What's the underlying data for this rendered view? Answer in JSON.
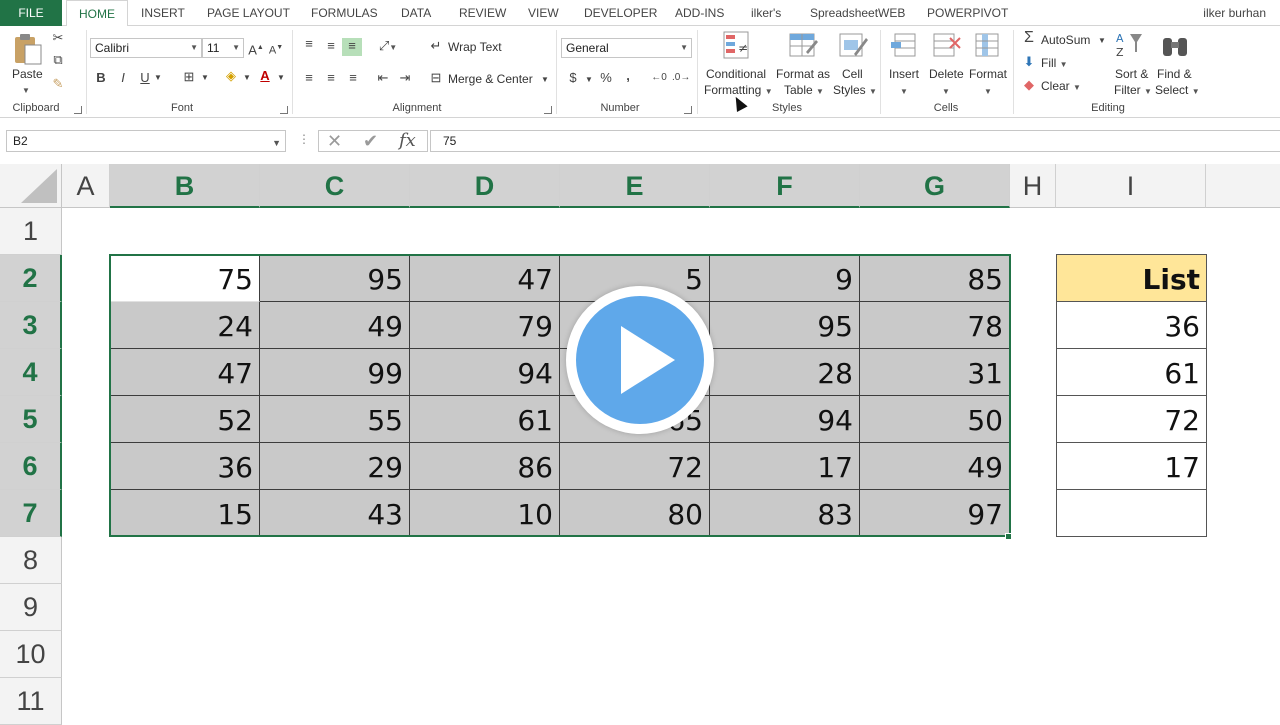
{
  "tabs": {
    "file": "FILE",
    "items": [
      "HOME",
      "INSERT",
      "PAGE LAYOUT",
      "FORMULAS",
      "DATA",
      "REVIEW",
      "VIEW",
      "DEVELOPER",
      "ADD-INS",
      "ilker's",
      "SpreadsheetWEB",
      "POWERPIVOT"
    ],
    "active": "HOME",
    "user": "ilker burhan"
  },
  "ribbon": {
    "clipboard": {
      "paste": "Paste",
      "label": "Clipboard"
    },
    "font": {
      "name": "Calibri",
      "size": "11",
      "label": "Font",
      "bold": "B",
      "italic": "I",
      "underline": "U"
    },
    "alignment": {
      "wrap": "Wrap Text",
      "merge": "Merge & Center",
      "label": "Alignment"
    },
    "number": {
      "format": "General",
      "label": "Number",
      "currency": "$",
      "percent": "%",
      "comma": ","
    },
    "styles": {
      "conditional_1": "Conditional",
      "conditional_2": "Formatting",
      "format_table_1": "Format as",
      "format_table_2": "Table",
      "cell_styles_1": "Cell",
      "cell_styles_2": "Styles",
      "label": "Styles"
    },
    "cells": {
      "insert": "Insert",
      "delete": "Delete",
      "format": "Format",
      "label": "Cells"
    },
    "editing": {
      "autosum": "AutoSum",
      "fill": "Fill",
      "clear": "Clear",
      "sort_1": "Sort &",
      "sort_2": "Filter",
      "find_1": "Find &",
      "find_2": "Select",
      "label": "Editing"
    }
  },
  "formula_bar": {
    "name_box": "B2",
    "formula": "75",
    "cancel_symbol": "✕",
    "enter_symbol": "✔",
    "fx_symbol": "fx"
  },
  "columns": [
    "A",
    "B",
    "C",
    "D",
    "E",
    "F",
    "G",
    "H",
    "I"
  ],
  "rows": [
    "1",
    "2",
    "3",
    "4",
    "5",
    "6",
    "7",
    "8",
    "9",
    "10",
    "11"
  ],
  "table": [
    [
      "75",
      "95",
      "47",
      "5",
      "9",
      "85"
    ],
    [
      "24",
      "49",
      "79",
      "",
      "95",
      "78"
    ],
    [
      "47",
      "99",
      "94",
      "",
      "28",
      "31"
    ],
    [
      "52",
      "55",
      "61",
      "65",
      "94",
      "50"
    ],
    [
      "36",
      "29",
      "86",
      "72",
      "17",
      "49"
    ],
    [
      "15",
      "43",
      "10",
      "80",
      "83",
      "97"
    ]
  ],
  "list": {
    "header": "List",
    "values": [
      "36",
      "61",
      "72",
      "17",
      ""
    ]
  },
  "selected_cell": "B2",
  "colors": {
    "accent": "#217346",
    "list_header": "#ffe699",
    "selection_shade": "#c9c9c9",
    "play": "#5fa8ea"
  }
}
